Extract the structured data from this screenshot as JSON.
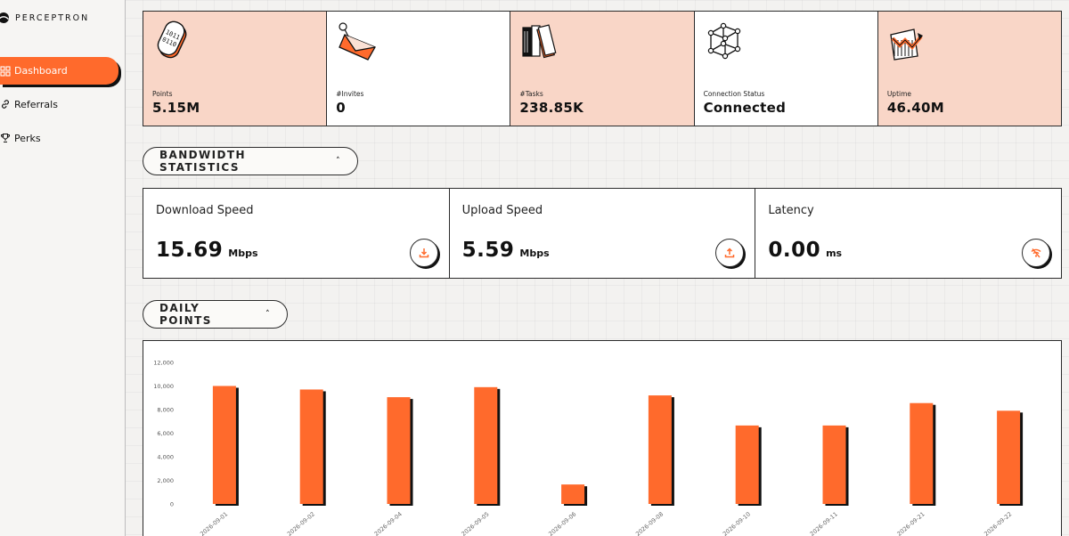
{
  "app": {
    "brand": "PERCEPTRON"
  },
  "sidebar": {
    "items": [
      {
        "label": "Dashboard",
        "icon": "grid-icon",
        "active": true
      },
      {
        "label": "Referrals",
        "icon": "link-icon",
        "active": false
      },
      {
        "label": "Perks",
        "icon": "trophy-icon",
        "active": false
      }
    ]
  },
  "stats": [
    {
      "label": "Points",
      "value": "5.15M",
      "icon": "binary-tag-icon"
    },
    {
      "label": "#Invites",
      "value": "0",
      "icon": "envelope-icon"
    },
    {
      "label": "#Tasks",
      "value": "238.85K",
      "icon": "books-icon"
    },
    {
      "label": "Connection Status",
      "value": "Connected",
      "icon": "cube-network-icon"
    },
    {
      "label": "Uptime",
      "value": "46.40M",
      "icon": "chart-cup-icon"
    }
  ],
  "sections": {
    "bandwidth_title": "BANDWIDTH STATISTICS",
    "daily_title": "DAILY POINTS"
  },
  "bandwidth": [
    {
      "title": "Download Speed",
      "value": "15.69",
      "unit": "Mbps",
      "icon": "download-icon"
    },
    {
      "title": "Upload Speed",
      "value": "5.59",
      "unit": "Mbps",
      "icon": "upload-icon"
    },
    {
      "title": "Latency",
      "value": "0.00",
      "unit": "ms",
      "icon": "wifi-off-icon"
    }
  ],
  "colors": {
    "accent": "#ff6a2c",
    "peach": "#f9d6c7",
    "ink": "#111111"
  },
  "chart_data": {
    "type": "bar",
    "categories": [
      "2026-09-01",
      "2026-09-02",
      "2026-09-04",
      "2026-09-05",
      "2026-09-06",
      "2026-09-08",
      "2026-09-10",
      "2026-09-11",
      "2026-09-21",
      "2026-09-22"
    ],
    "series": [
      {
        "values": [
          10000,
          9700,
          9050,
          9900,
          1650,
          9200,
          6650,
          6650,
          8550,
          7900
        ]
      }
    ],
    "yticks": [
      "0",
      "2,000",
      "4,000",
      "6,000",
      "8,000",
      "10,000",
      "12,000"
    ],
    "ylim": [
      0,
      12000
    ],
    "grid": false,
    "legend": "none"
  }
}
